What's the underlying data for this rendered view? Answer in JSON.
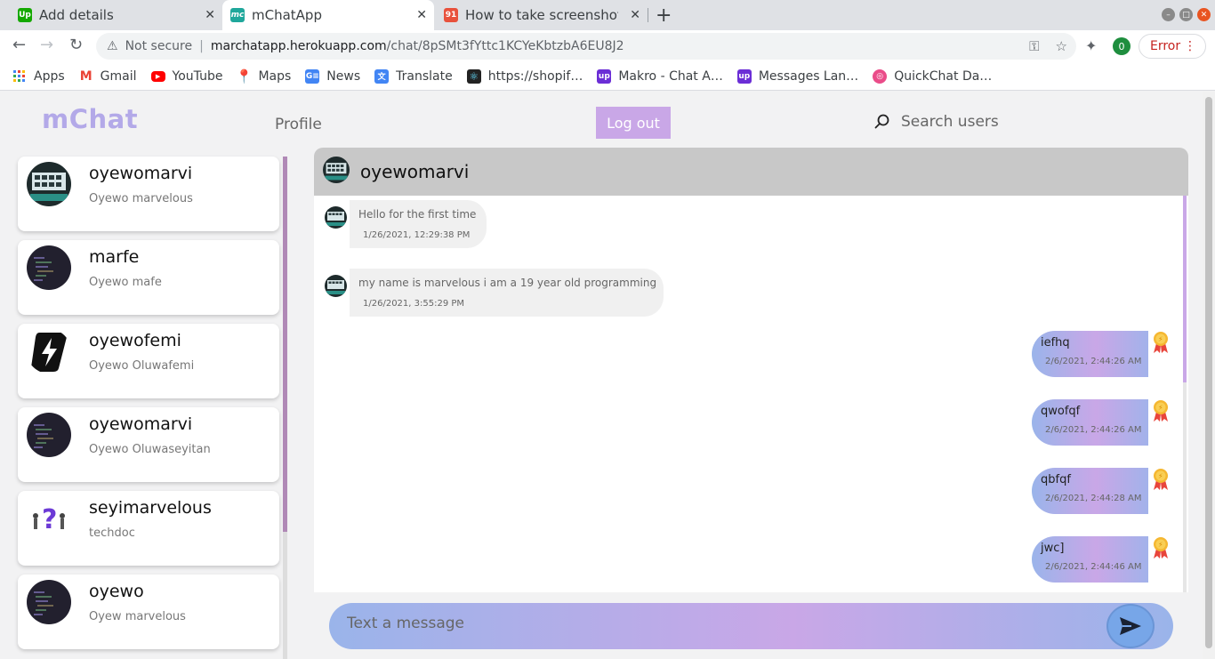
{
  "browser": {
    "tabs": [
      {
        "title": "Add details",
        "favicon": "Up",
        "favicon_color": "#14a800"
      },
      {
        "title": "mChatApp",
        "favicon": "mc",
        "favicon_color": "#1fa79b"
      },
      {
        "title": "How to take screenshots",
        "favicon": "91",
        "favicon_color": "#e8513c"
      }
    ],
    "omnibox": {
      "security": "Not secure",
      "host": "marchatapp.herokuapp.com",
      "path": "/chat/8pSMt3fYttc1KCYeKbtzbA6EU8J2"
    },
    "profile_initial": "0",
    "error_label": "Error",
    "bookmarks": [
      {
        "label": "Apps",
        "icon": "apps-grid-icon",
        "color": "#4285f4"
      },
      {
        "label": "Gmail",
        "icon": "gmail-icon",
        "color": "#ea4335"
      },
      {
        "label": "YouTube",
        "icon": "youtube-icon",
        "color": "#ff0000"
      },
      {
        "label": "Maps",
        "icon": "maps-icon",
        "color": "#34a853"
      },
      {
        "label": "News",
        "icon": "news-icon",
        "color": "#4285f4"
      },
      {
        "label": "Translate",
        "icon": "translate-icon",
        "color": "#4285f4"
      },
      {
        "label": "https://shopif…",
        "icon": "react-icon",
        "color": "#222222"
      },
      {
        "label": "Makro - Chat A…",
        "icon": "upwork-icon",
        "color": "#6b2ed6"
      },
      {
        "label": "Messages Lan…",
        "icon": "upwork-icon",
        "color": "#6b2ed6"
      },
      {
        "label": "QuickChat Da…",
        "icon": "dribbble-icon",
        "color": "#ea4c89"
      }
    ]
  },
  "app": {
    "logo": "mChat",
    "nav_profile": "Profile",
    "logout": "Log out",
    "search_placeholder": "Search users"
  },
  "contacts": [
    {
      "username": "oyewomarvi",
      "fullname": "Oyewo marvelous",
      "avatar": "screen-avatar"
    },
    {
      "username": "marfe",
      "fullname": "Oyewo mafe",
      "avatar": "code-avatar"
    },
    {
      "username": "oyewofemi",
      "fullname": "Oyewo Oluwafemi",
      "avatar": "lightning-avatar"
    },
    {
      "username": "oyewomarvi",
      "fullname": "Oyewo Oluwaseyitan",
      "avatar": "code-avatar"
    },
    {
      "username": "seyimarvelous",
      "fullname": "techdoc",
      "avatar": "question-avatar"
    },
    {
      "username": "oyewo",
      "fullname": "Oyew marvelous",
      "avatar": "code-avatar"
    }
  ],
  "chat": {
    "header_name": "oyewomarvi",
    "incoming": [
      {
        "text": "Hello for the first time",
        "time": "1/26/2021, 12:29:38 PM"
      },
      {
        "text": "my name is marvelous i am a 19 year old programming",
        "time": "1/26/2021, 3:55:29 PM"
      }
    ],
    "outgoing": [
      {
        "text": "iefhq",
        "time": "2/6/2021, 2:44:26 AM"
      },
      {
        "text": "qwofqf",
        "time": "2/6/2021, 2:44:26 AM"
      },
      {
        "text": "qbfqf",
        "time": "2/6/2021, 2:44:28 AM"
      },
      {
        "text": "jwc]",
        "time": "2/6/2021, 2:44:46 AM"
      }
    ],
    "composer_placeholder": "Text a message"
  },
  "colors": {
    "accent": "#c9a7e7",
    "gradient_blue": "#9ab4ea",
    "logo": "#b3a9e8",
    "header_bar": "#c8c8c8"
  }
}
